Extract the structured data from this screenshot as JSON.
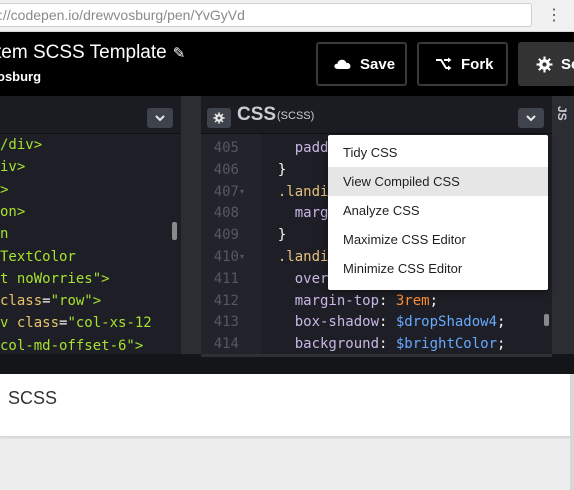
{
  "browser": {
    "url_domain": "://codepen.io/",
    "url_path": "drewvosburg/pen/YvGyVd",
    "menu_icon": "kebab-icon"
  },
  "header": {
    "title": "tem SCSS Template",
    "author": "osburg",
    "save_label": "Save",
    "fork_label": "Fork",
    "settings_label": "Se"
  },
  "left_editor": {
    "lines": [
      {
        "parts": [
          {
            "t": "/div>",
            "c": "c-tag"
          }
        ]
      },
      {
        "parts": [
          {
            "t": "iv>",
            "c": "c-tag"
          }
        ]
      },
      {
        "parts": [
          {
            "t": ">",
            "c": "c-tag"
          }
        ]
      },
      {
        "parts": [
          {
            "t": "on>",
            "c": "c-tag"
          }
        ]
      },
      {
        "parts": [
          {
            "t": "n",
            "c": "c-tag"
          }
        ]
      },
      {
        "parts": [
          {
            "t": "TextColor",
            "c": "c-tag"
          }
        ]
      },
      {
        "parts": [
          {
            "t": "t noWorries\">",
            "c": "c-tag"
          }
        ]
      },
      {
        "parts": [
          {
            "t": "class",
            "c": "c-attr"
          },
          {
            "t": "=",
            "c": "c-txt"
          },
          {
            "t": "\"row\">",
            "c": "c-str"
          }
        ]
      },
      {
        "parts": [
          {
            "t": "v ",
            "c": "c-tag"
          },
          {
            "t": "class",
            "c": "c-attr"
          },
          {
            "t": "=",
            "c": "c-txt"
          },
          {
            "t": "\"col-xs-12",
            "c": "c-str"
          }
        ]
      },
      {
        "parts": [
          {
            "t": "col-md-offset-6\">",
            "c": "c-str"
          }
        ]
      }
    ]
  },
  "css_editor": {
    "title": "CSS",
    "subtitle": "(SCSS)",
    "line_numbers": [
      "405",
      "406",
      "407",
      "408",
      "409",
      "410",
      "411",
      "412",
      "413",
      "414"
    ],
    "folds": [
      false,
      false,
      true,
      false,
      false,
      true,
      false,
      false,
      false,
      false
    ],
    "lines": [
      {
        "parts": [
          {
            "t": "    paddi",
            "c": "c-prop"
          }
        ]
      },
      {
        "parts": [
          {
            "t": "  }",
            "c": "c-punc"
          }
        ]
      },
      {
        "parts": [
          {
            "t": "  .landir",
            "c": "c-sel"
          }
        ]
      },
      {
        "parts": [
          {
            "t": "    margi",
            "c": "c-prop"
          }
        ]
      },
      {
        "parts": [
          {
            "t": "  }",
            "c": "c-punc"
          }
        ]
      },
      {
        "parts": [
          {
            "t": "  .landir",
            "c": "c-sel"
          }
        ]
      },
      {
        "parts": [
          {
            "t": "    overf",
            "c": "c-prop"
          }
        ]
      },
      {
        "parts": [
          {
            "t": "    margin-top",
            "c": "c-prop"
          },
          {
            "t": ": ",
            "c": "c-punc"
          },
          {
            "t": "3rem",
            "c": "c-num"
          },
          {
            "t": ";",
            "c": "c-punc"
          }
        ]
      },
      {
        "parts": [
          {
            "t": "    box-shadow",
            "c": "c-prop"
          },
          {
            "t": ": ",
            "c": "c-punc"
          },
          {
            "t": "$dropShadow4",
            "c": "c-var"
          },
          {
            "t": ";",
            "c": "c-punc"
          }
        ]
      },
      {
        "parts": [
          {
            "t": "    background",
            "c": "c-prop"
          },
          {
            "t": ": ",
            "c": "c-punc"
          },
          {
            "t": "$brightColor",
            "c": "c-var"
          },
          {
            "t": ";",
            "c": "c-punc"
          }
        ]
      }
    ]
  },
  "js_panel": {
    "label": "JS"
  },
  "dropdown": {
    "items": [
      {
        "label": "Tidy CSS",
        "highlighted": false
      },
      {
        "label": "View Compiled CSS",
        "highlighted": true
      },
      {
        "label": "Analyze CSS",
        "highlighted": false
      },
      {
        "label": "Maximize CSS Editor",
        "highlighted": false
      },
      {
        "label": "Minimize CSS Editor",
        "highlighted": false
      }
    ]
  },
  "preview": {
    "text": "SCSS"
  },
  "colors": {
    "header_bg": "#000000",
    "editor_bg": "#1e1f26",
    "menu_highlight": "#e6e6e6"
  }
}
